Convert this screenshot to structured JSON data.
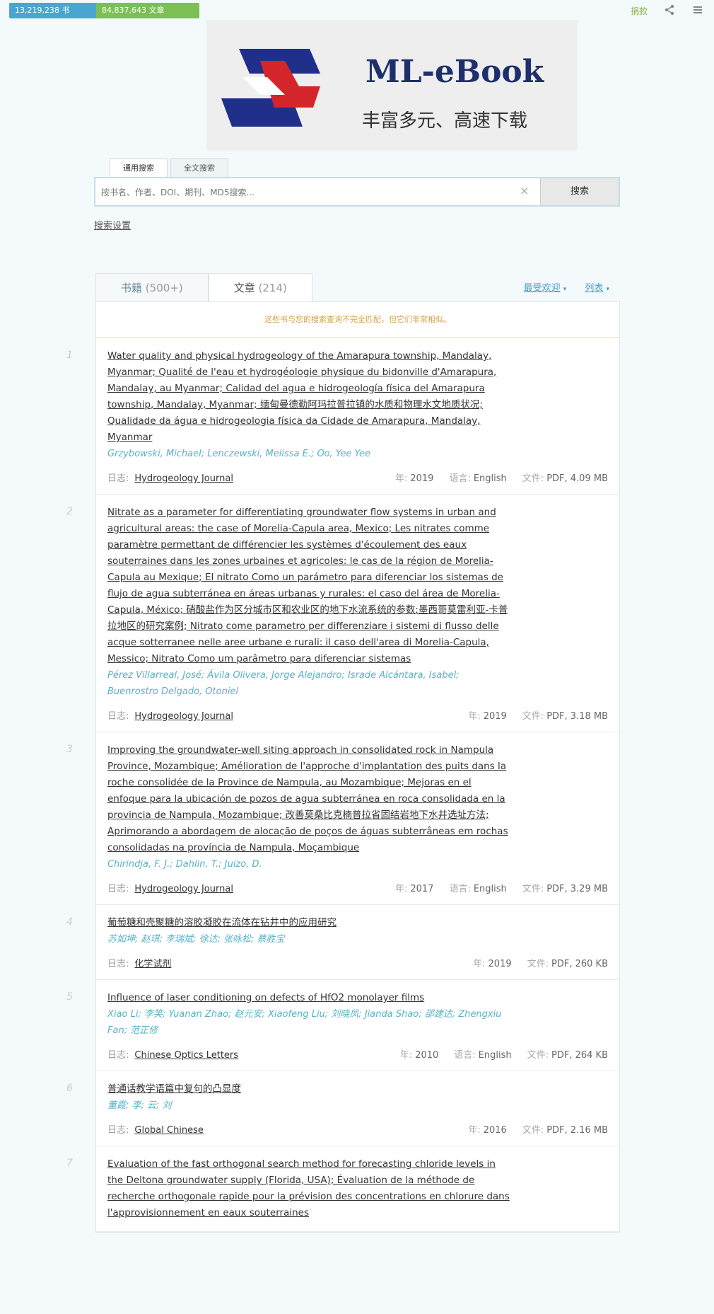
{
  "top": {
    "books_count": "13,219,238 书",
    "articles_count": "84,837,643 文章",
    "donate_label": "捐款"
  },
  "logo": {
    "title": "ML-eBook",
    "subtitle": "丰富多元、高速下载",
    "colors": {
      "blue": "#1f2f8a",
      "red": "#d4252b"
    }
  },
  "search": {
    "tabs": [
      "通用搜索",
      "全文搜索"
    ],
    "placeholder": "按书名、作者、DOI、期刊、MD5搜索...",
    "button_label": "搜索",
    "settings_label": "搜索设置"
  },
  "results_tabs": {
    "books_label": "书籍",
    "books_count": "(500+)",
    "articles_label": "文章",
    "articles_count": "(214)",
    "sort_label": "最受欢迎",
    "view_label": "列表"
  },
  "notice": "这些书与您的搜索查询不完全匹配，但它们非常相似。",
  "meta_labels": {
    "journal": "日志:",
    "year": "年:",
    "language": "语言:",
    "file": "文件:"
  },
  "items": [
    {
      "num": "1",
      "title": "Water quality and physical hydrogeology of the Amarapura township, Mandalay, Myanmar; Qualité de l'eau et hydrogéologie physique du bidonville d'Amarapura, Mandalay, au Myanmar; Calidad del agua e hidrogeología física del Amarapura township, Mandalay, Myanmar; 缅甸曼德勒阿玛拉普拉镇的水质和物理水文地质状况; Qualidade da água e hidrogeologia física da Cidade de Amarapura, Mandalay, Myanmar",
      "authors": "Grzybowski, Michael; Lenczewski, Melissa E.; Oo, Yee Yee",
      "journal": "Hydrogeology Journal",
      "year": "2019",
      "language": "English",
      "file": "PDF, 4.09 MB"
    },
    {
      "num": "2",
      "title": "Nitrate as a parameter for differentiating groundwater flow systems in urban and agricultural areas: the case of Morelia-Capula area, Mexico; Les nitrates comme paramètre permettant de différencier les systèmes d'écoulement des eaux souterraines dans les zones urbaines et agricoles: le cas de la région de Morelia-Capula au Mexique; El nitrato Como un parámetro para diferenciar los sistemas de flujo de agua subterránea en áreas urbanas y rurales: el caso del área de Morelia-Capula, México; 硝酸盐作为区分城市区和农业区的地下水流系统的参数:墨西哥莫雷利亚-卡普拉地区的研究案例; Nitrato come parametro per differenziare i sistemi di flusso delle acque sotterranee nelle aree urbane e rurali: il caso dell'area di Morelia-Capula, Messico; Nitrato Como um parâmetro para diferenciar sistemas",
      "authors": "Pérez Villarreal, José; Ávila Olivera, Jorge Alejandro; Israde Alcántara, Isabel; Buenrostro Delgado, Otoniel",
      "journal": "Hydrogeology Journal",
      "year": "2019",
      "language": "",
      "file": "PDF, 3.18 MB"
    },
    {
      "num": "3",
      "title": "Improving the groundwater-well siting approach in consolidated rock in Nampula Province, Mozambique; Amélioration de l'approche d'implantation des puits dans la roche consolidée de la Province de Nampula, au Mozambique; Mejoras en el enfoque para la ubicación de pozos de agua subterránea en roca consolidada en la provincia de Nampula, Mozambique; 改善莫桑比克楠普拉省固结岩地下水井选址方法; Aprimorando a abordagem de alocação de poços de águas subterrâneas em rochas consolidadas na província de Nampula, Moçambique",
      "authors": "Chirindja, F. J.; Dahlin, T.; Juizo, D.",
      "journal": "Hydrogeology Journal",
      "year": "2017",
      "language": "English",
      "file": "PDF, 3.29 MB"
    },
    {
      "num": "4",
      "title": "葡萄糖和壳聚糖的溶胶凝胶在流体在钻井中的应用研究",
      "authors": "苏如坤; 赵琪; 李瑞斌; 徐达; 张咏松; 蔡胜宝",
      "journal": "化学试剂",
      "year": "2019",
      "language": "",
      "file": "PDF, 260 KB"
    },
    {
      "num": "5",
      "title": "Influence of laser conditioning on defects of HfO2 monolayer films",
      "authors": "Xiao Li; 李笑; Yuanan Zhao; 赵元安; Xiaofeng Liu; 刘晓凤; Jianda Shao; 邵建达; Zhengxiu Fan; 范正修",
      "journal": "Chinese Optics Letters",
      "year": "2010",
      "language": "English",
      "file": "PDF, 264 KB"
    },
    {
      "num": "6",
      "title": "普通话教学语篇中复句的凸显度",
      "authors": "董霞; 李; 云; 刘",
      "journal": "Global Chinese",
      "year": "2016",
      "language": "",
      "file": "PDF, 2.16 MB"
    },
    {
      "num": "7",
      "title": "Evaluation of the fast orthogonal search method for forecasting chloride levels in the Deltona groundwater supply (Florida, USA); Évaluation de la méthode de recherche orthogonale rapide pour la prévision des concentrations en chlorure dans l'approvisionnement en eaux souterraines",
      "authors": "",
      "journal": "",
      "year": "",
      "language": "",
      "file": ""
    }
  ]
}
